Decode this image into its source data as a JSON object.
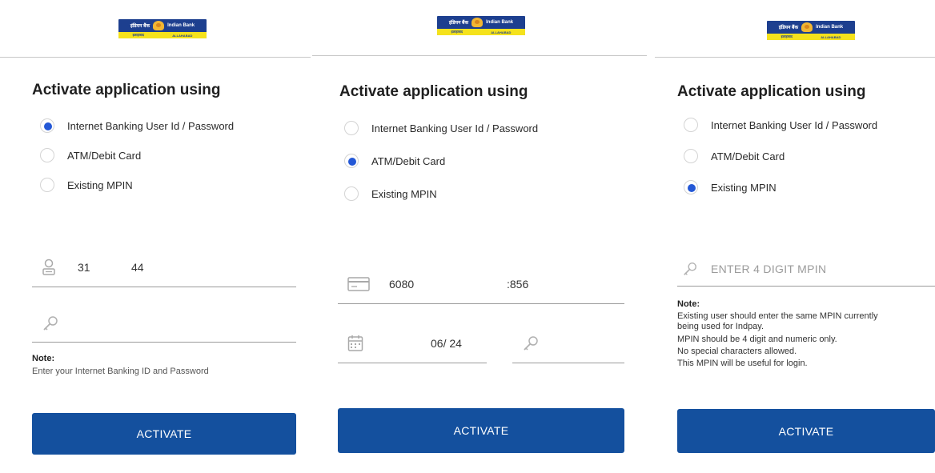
{
  "bank": {
    "name": "Indian Bank",
    "name_hindi": "इंडियन बैंक",
    "sub_left": "इलाहाबाद",
    "sub_right": "ALLAHABAD"
  },
  "panels": [
    {
      "heading": "Activate application using",
      "options": [
        {
          "label": "Internet Banking User Id / Password",
          "selected": true
        },
        {
          "label": "ATM/Debit Card",
          "selected": false
        },
        {
          "label": "Existing MPIN",
          "selected": false
        }
      ],
      "user_id_part1": "31",
      "user_id_part2": "44",
      "password_value": "",
      "note_label": "Note:",
      "note_text": "Enter your Internet Banking ID and Password",
      "button_label": "ACTIVATE"
    },
    {
      "heading": "Activate application using",
      "options": [
        {
          "label": "Internet Banking User Id / Password",
          "selected": false
        },
        {
          "label": "ATM/Debit Card",
          "selected": true
        },
        {
          "label": "Existing MPIN",
          "selected": false
        }
      ],
      "card_part1": "6080",
      "card_part2": ":856",
      "expiry_value": "06/ 24",
      "pin_value": "",
      "button_label": "ACTIVATE"
    },
    {
      "heading": "Activate application using",
      "options": [
        {
          "label": "Internet Banking User Id / Password",
          "selected": false
        },
        {
          "label": "ATM/Debit Card",
          "selected": false
        },
        {
          "label": "Existing MPIN",
          "selected": true
        }
      ],
      "mpin_placeholder": "ENTER 4 DIGIT MPIN",
      "note_label": "Note:",
      "note_lines": [
        "Existing user should enter the same MPIN currently",
        "being used for Indpay.",
        "MPIN should be 4 digit and numeric only.",
        "No special characters allowed.",
        "This MPIN will be useful for login."
      ],
      "button_label": "ACTIVATE"
    }
  ],
  "colors": {
    "button": "#14509e",
    "radio_selected": "#2458d6",
    "logo_blue": "#1d3f8f",
    "logo_yellow": "#f5e21c"
  }
}
